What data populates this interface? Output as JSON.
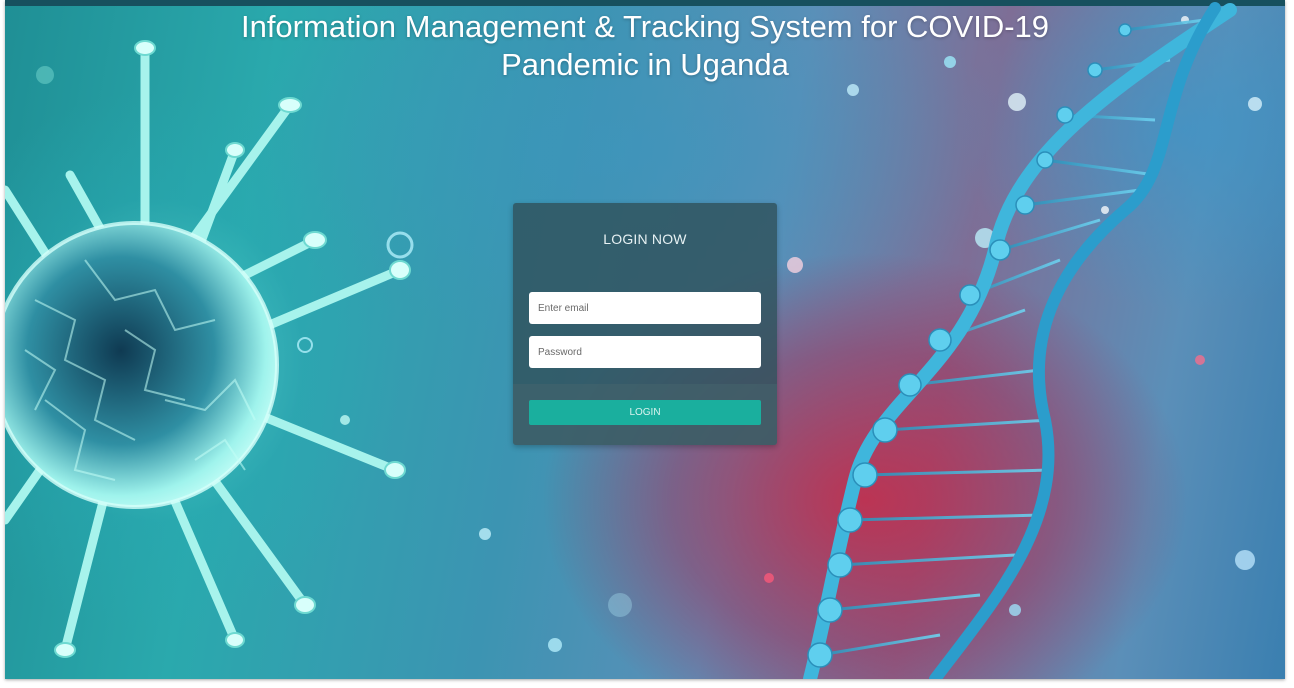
{
  "header": {
    "title_line1": "Information Management & Tracking System for COVID-19",
    "title_line2": "Pandemic in Uganda"
  },
  "login": {
    "heading": "LOGIN NOW",
    "email_placeholder": "Enter email",
    "password_placeholder": "Password",
    "button_label": "LOGIN"
  },
  "colors": {
    "top_strip": "#17505e",
    "button": "#1aaf9e",
    "card": "#30525c"
  },
  "background": {
    "icons": [
      "virus-illustration",
      "dna-helix-illustration"
    ]
  }
}
